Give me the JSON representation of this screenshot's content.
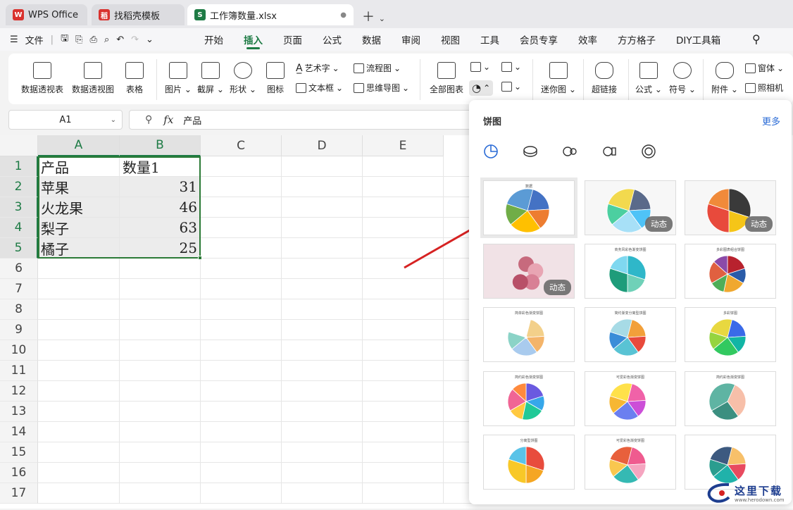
{
  "tabs": [
    {
      "label": "WPS Office",
      "color": "#d9322e"
    },
    {
      "label": "找稻壳模板",
      "color": "#d9322e"
    },
    {
      "label": "工作簿数量.xlsx",
      "color": "#1e7b45",
      "icon_letter": "S"
    }
  ],
  "menubar": {
    "file_label": "文件",
    "tabs": [
      "开始",
      "插入",
      "页面",
      "公式",
      "数据",
      "审阅",
      "视图",
      "工具",
      "会员专享",
      "效率",
      "方方格子",
      "DIY工具箱"
    ],
    "active_tab": "插入"
  },
  "ribbon": {
    "pivot_table": "数据透视表",
    "pivot_chart": "数据透视图",
    "table": "表格",
    "picture": "图片",
    "screenshot": "截屏",
    "shape": "形状",
    "icon": "图标",
    "wordart": "艺术字",
    "textbox": "文本框",
    "flowchart": "流程图",
    "mindmap": "思维导图",
    "all_charts": "全部图表",
    "sparkline": "迷你图",
    "hyperlink": "超链接",
    "formula": "公式",
    "symbol": "符号",
    "attachment": "附件",
    "form": "窗体",
    "camera": "照相机"
  },
  "formula_bar": {
    "cell_ref": "A1",
    "fx": "fx",
    "value": "产品"
  },
  "sheet": {
    "columns": [
      "A",
      "B",
      "C",
      "D",
      "E"
    ],
    "rows": [
      "1",
      "2",
      "3",
      "4",
      "5",
      "6",
      "7",
      "8",
      "9",
      "10",
      "11",
      "12",
      "13",
      "14",
      "15",
      "16",
      "17"
    ],
    "data": [
      [
        "产品",
        "数量1"
      ],
      [
        "苹果",
        "31"
      ],
      [
        "火龙果",
        "46"
      ],
      [
        "梨子",
        "63"
      ],
      [
        "橘子",
        "25"
      ]
    ]
  },
  "chart_panel": {
    "title": "饼图",
    "more": "更多",
    "dynamic_badge": "动态",
    "thumb_titles": [
      "数据",
      "",
      "",
      "",
      "商务风彩色渐变饼图",
      "多彩图表组合饼图",
      "简单彩色渐变饼图",
      "简约渐变分离型饼图",
      "多彩饼图",
      "简约彩色渐变饼图",
      "可爱彩色渐变饼图",
      "简约彩色渐变饼图",
      "分离型饼图",
      "可爱彩色渐变饼图",
      ""
    ]
  },
  "watermark": {
    "text": "这里下载",
    "url": "www.herodown.com"
  }
}
